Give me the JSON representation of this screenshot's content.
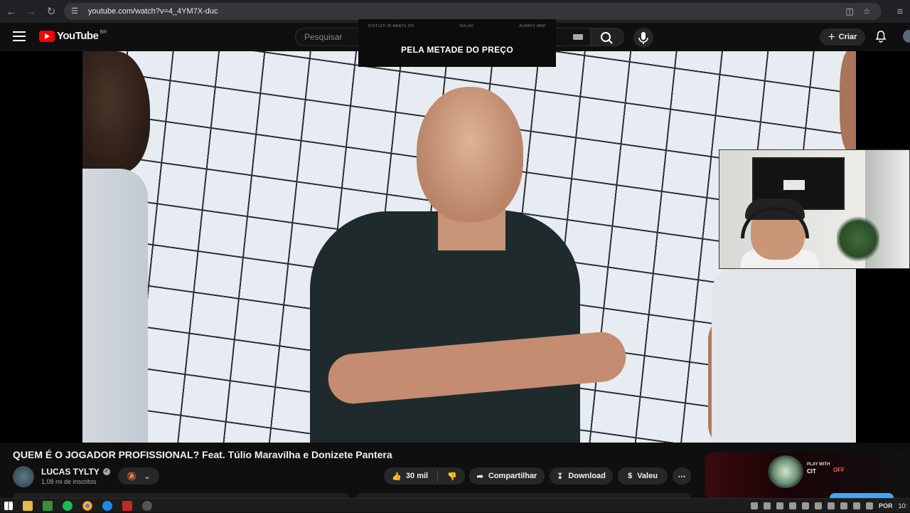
{
  "browser": {
    "url": "youtube.com/watch?v=4_4YM7X-duc"
  },
  "header": {
    "logo_text": "YouTube",
    "country_code": "BR",
    "search_placeholder": "Pesquisar",
    "create_label": "Criar"
  },
  "player": {
    "sponsor_top": [
      "DISTLED IN AWAYS ON",
      "NOLAO",
      "ALWAYS MND"
    ],
    "sponsor_text": "PELA METADE DO PREÇO"
  },
  "video": {
    "title": "QUEM É O JOGADOR PROFISSIONAL? Feat. Túlio Maravilha e Donizete Pantera",
    "channel_name": "LUCAS TYLTY",
    "subscribers": "1,08 mi de inscritos",
    "likes": "30 mil",
    "share_label": "Compartilhar",
    "download_label": "Download",
    "thanks_label": "Valeu"
  },
  "ad": {
    "brand_line1": "PLAY WITH",
    "brand_line2": "CIT",
    "off_text": "OFF"
  },
  "taskbar": {
    "language": "POR",
    "clock": "10:"
  }
}
